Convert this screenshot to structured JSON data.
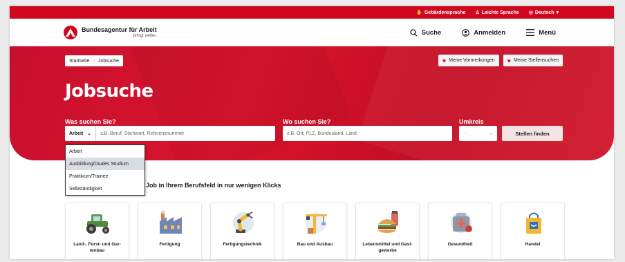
{
  "topbar": {
    "items": [
      {
        "label": "Gebärdensprache",
        "icon": "hand-icon"
      },
      {
        "label": "Leichte Sprache",
        "icon": "easy-language-icon"
      },
      {
        "label": "Deutsch",
        "icon": "globe-icon"
      }
    ]
  },
  "header": {
    "logo_title": "Bundesagentur für Arbeit",
    "logo_sub": "bringt weiter.",
    "search_label": "Suche",
    "login_label": "Anmelden",
    "menu_label": "Menü"
  },
  "breadcrumb": {
    "home": "Startseite",
    "current": "Jobsuche"
  },
  "hero_links": {
    "bookmarks": "Meine Vormerkungen",
    "searches": "Meine Stellensuchen"
  },
  "hero_title": "Jobsuche",
  "search": {
    "what_label": "Was suchen Sie?",
    "what_selected": "Arbeit",
    "what_placeholder": "z.B. Beruf, Stichwort, Referenznummer",
    "where_label": "Wo suchen Sie?",
    "where_placeholder": "z.B. Ort, PLZ, Bundesland, Land",
    "radius_label": "Umkreis",
    "radius_value": "--",
    "find_button": "Stellen finden"
  },
  "dropdown": {
    "options": [
      "Arbeit",
      "Ausbildung/Duales Studium",
      "Praktikum/Trainee",
      "Selbständigkeit"
    ],
    "highlighted_index": 1
  },
  "section_title": "Job in Ihrem Berufsfeld in nur wenigen Klicks",
  "categories": [
    {
      "label": "Land-, Forst- und Gar-tenbau",
      "icon": "tractor-icon"
    },
    {
      "label": "Fertigung",
      "icon": "factory-icon"
    },
    {
      "label": "Fertigungstechnik",
      "icon": "robot-arm-icon"
    },
    {
      "label": "Bau und Ausbau",
      "icon": "crane-icon"
    },
    {
      "label": "Lebensmittel und Gast-gewerbe",
      "icon": "food-icon"
    },
    {
      "label": "Gesundheit",
      "icon": "medical-kit-icon"
    },
    {
      "label": "Handel",
      "icon": "shopping-bag-icon"
    }
  ],
  "colors": {
    "brand": "#d2061e",
    "hero": "#ce1126",
    "button": "#f3e3e3"
  }
}
